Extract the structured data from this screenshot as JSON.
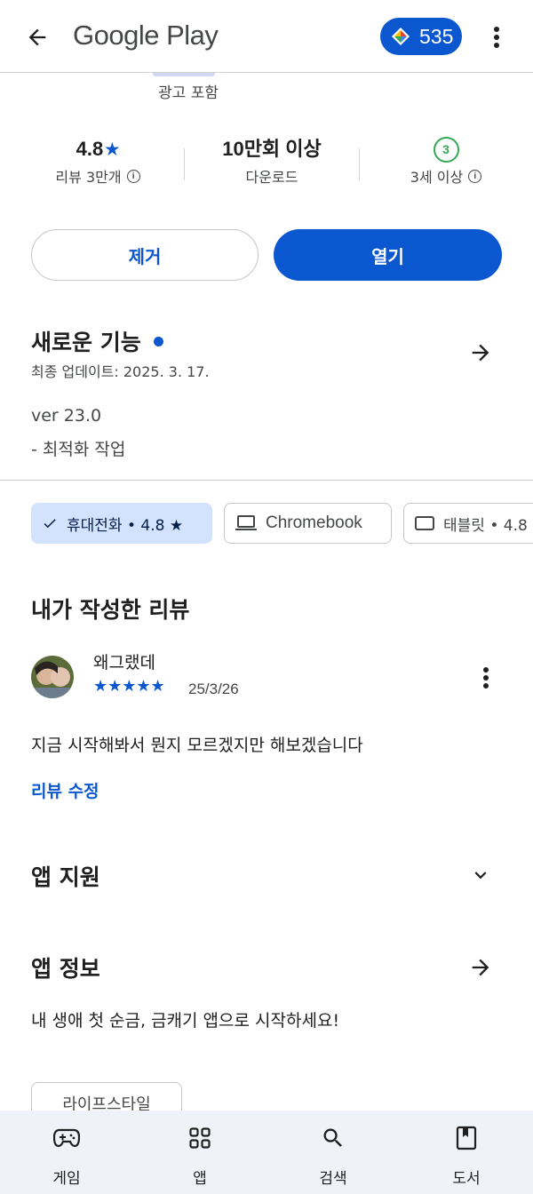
{
  "header": {
    "title": "Google Play",
    "points": "535"
  },
  "app": {
    "ads_note": "광고 포함",
    "rating": "4.8",
    "rating_star": "★",
    "reviews_label": "리뷰 3만개",
    "downloads": "10만회 이상",
    "downloads_label": "다운로드",
    "age_rating": "3",
    "age_label": "3세 이상"
  },
  "actions": {
    "remove_label": "제거",
    "open_label": "열기"
  },
  "whats_new": {
    "title": "새로운 기능",
    "last_updated": "최종 업데이트: 2025. 3. 17.",
    "version": "ver 23.0",
    "note": "- 최적화 작업"
  },
  "device_chips": [
    {
      "label": "휴대전화 • 4.8 ★",
      "selected": true
    },
    {
      "label": "Chromebook",
      "selected": false
    },
    {
      "label": "태블릿 • 4.8",
      "selected": false
    }
  ],
  "my_review": {
    "title": "내가 작성한 리뷰",
    "author": "왜그랬데",
    "stars": "★★★★★",
    "rating_value": 5,
    "date": "25/3/26",
    "text": "지금 시작해봐서 뭔지 모르겠지만 해보겠습니다",
    "edit_label": "리뷰 수정"
  },
  "support": {
    "title": "앱 지원"
  },
  "app_info": {
    "title": "앱 정보",
    "description": "내 생애 첫 순금, 금캐기 앱으로 시작하세요!",
    "category": "라이프스타일"
  },
  "bottom_nav": [
    {
      "label": "게임",
      "icon": "gamepad-icon"
    },
    {
      "label": "앱",
      "icon": "apps-grid-icon"
    },
    {
      "label": "검색",
      "icon": "search-icon"
    },
    {
      "label": "도서",
      "icon": "book-icon"
    }
  ],
  "colors": {
    "accent": "#0b57d0",
    "selected_chip": "#d3e3fd",
    "age_badge": "#34a853",
    "nav_bg": "#eff3f8"
  }
}
